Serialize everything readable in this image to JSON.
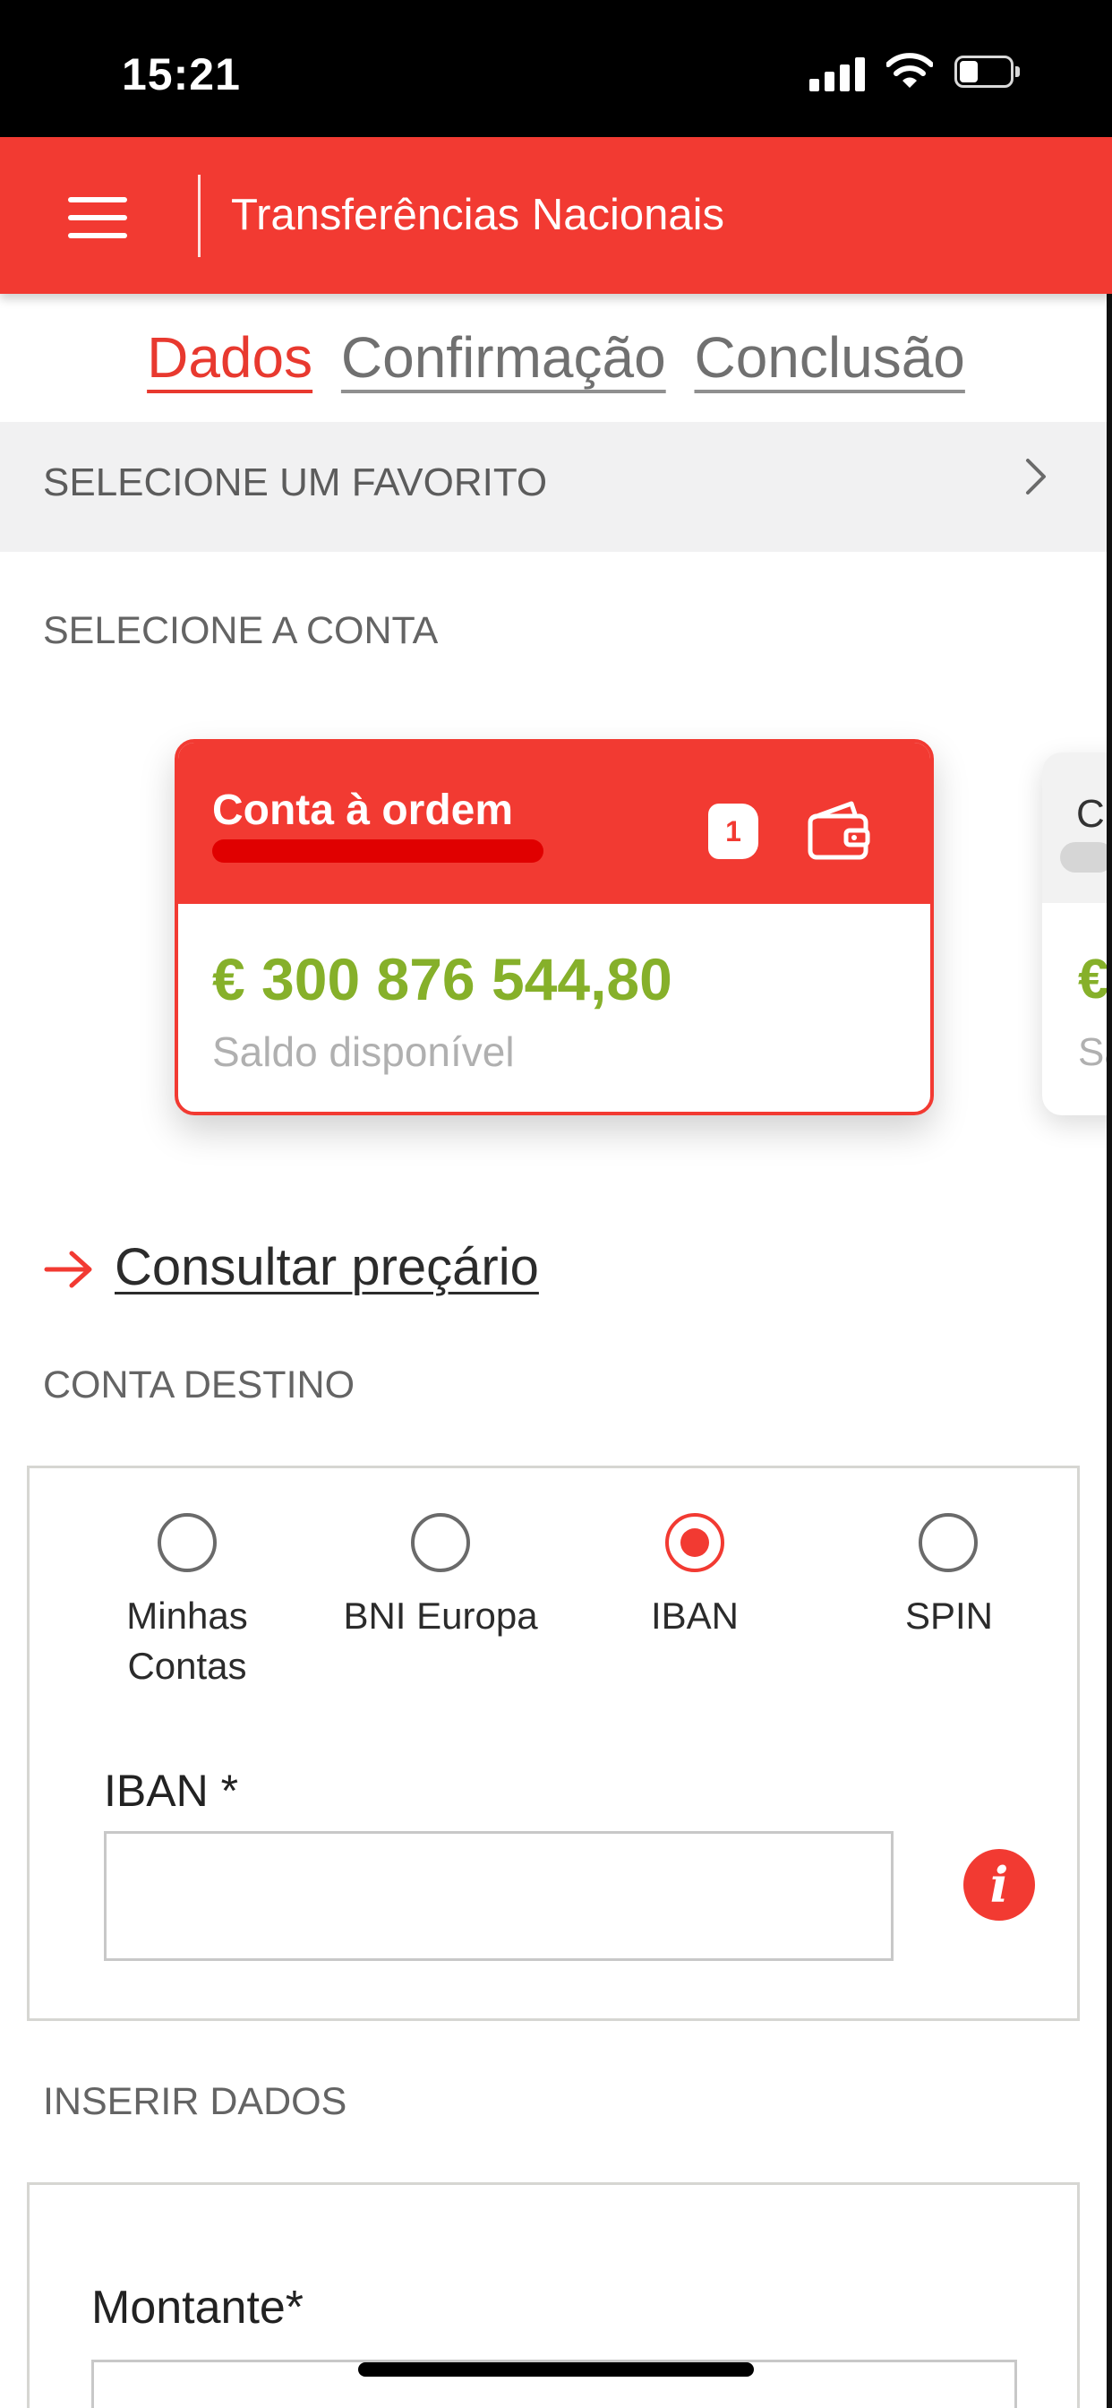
{
  "status_bar": {
    "time": "15:21"
  },
  "header": {
    "title": "Transferências Nacionais"
  },
  "steps": [
    {
      "label": "Dados",
      "active": true
    },
    {
      "label": "Confirmação",
      "active": false
    },
    {
      "label": "Conclusão",
      "active": false
    }
  ],
  "favorite": {
    "label": "SELECIONE UM FAVORITO"
  },
  "account_section": {
    "label": "SELECIONE A CONTA"
  },
  "account_card": {
    "name": "Conta à ordem",
    "badge": "1",
    "amount": "€ 300 876 544,80",
    "subtitle": "Saldo disponível"
  },
  "next_card": {
    "name": "C",
    "amount": "€",
    "subtitle": "Sa"
  },
  "pricing_link": "Consultar preçário",
  "destination": {
    "label": "CONTA DESTINO",
    "options": [
      {
        "label_line1": "Minhas",
        "label_line2": "Contas",
        "selected": false
      },
      {
        "label_line1": "BNI Europa",
        "label_line2": "",
        "selected": false
      },
      {
        "label_line1": "IBAN",
        "label_line2": "",
        "selected": true
      },
      {
        "label_line1": "SPIN",
        "label_line2": "",
        "selected": false
      }
    ],
    "iban_label": "IBAN *",
    "iban_value": ""
  },
  "insert_data": {
    "label": "INSERIR DADOS",
    "amount_label": "Montante*"
  },
  "colors": {
    "brand_red": "#f23a32",
    "amount_green": "#86b02a",
    "status_bar": "#000000"
  },
  "icons": [
    "menu-icon",
    "chevron-right-icon",
    "wallet-icon",
    "arrow-right-icon",
    "info-icon",
    "signal-icon",
    "wifi-icon",
    "battery-icon"
  ]
}
